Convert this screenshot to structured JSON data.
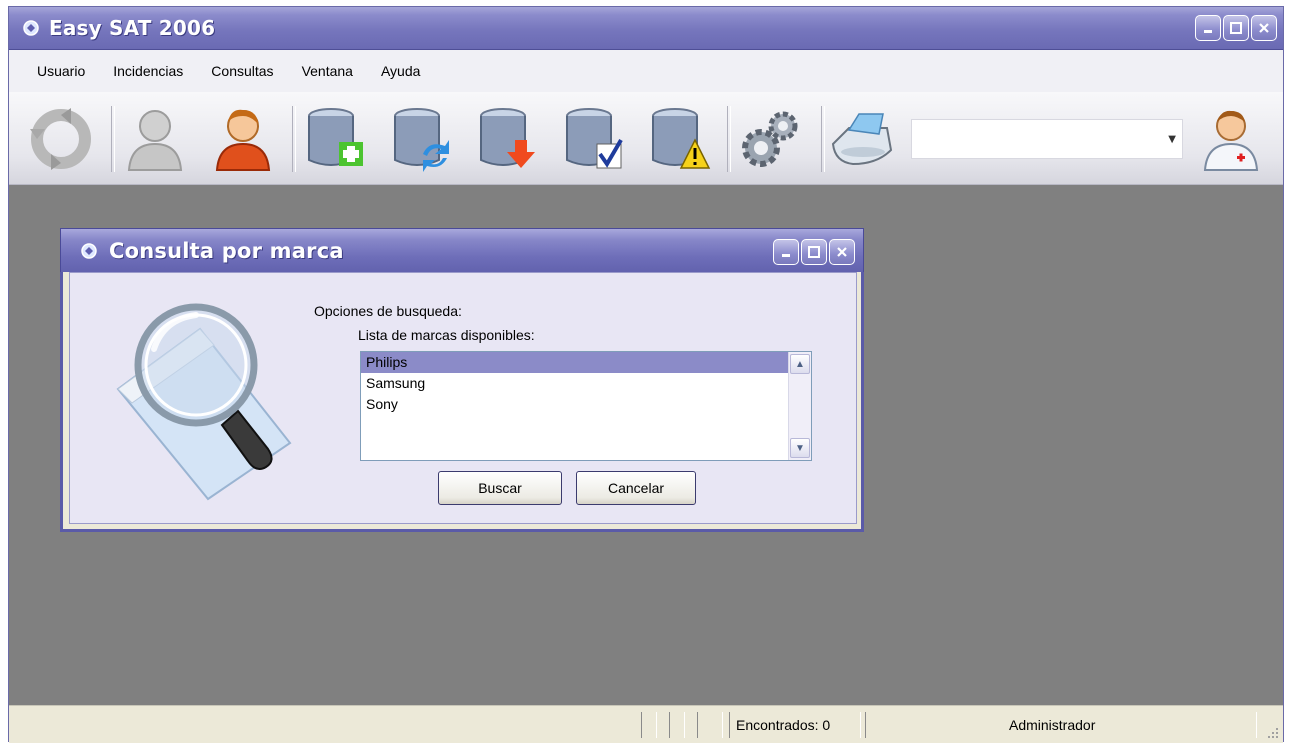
{
  "app": {
    "title": "Easy SAT 2006"
  },
  "menu": [
    {
      "label": "Usuario"
    },
    {
      "label": "Incidencias"
    },
    {
      "label": "Consultas"
    },
    {
      "label": "Ventana"
    },
    {
      "label": "Ayuda"
    }
  ],
  "toolbar": {
    "icons": [
      "refresh-icon",
      "user-gray-icon",
      "user-orange-icon",
      "database-add-icon",
      "database-sync-icon",
      "database-download-icon",
      "database-check-icon",
      "database-warning-icon",
      "gears-icon",
      "printer-icon",
      "doctor-user-icon"
    ],
    "combo_value": ""
  },
  "dialog": {
    "title": "Consulta por marca",
    "options_label": "Opciones de busqueda:",
    "list_label": "Lista de marcas disponibles:",
    "brands": [
      "Philips",
      "Samsung",
      "Sony"
    ],
    "selected": "Philips",
    "search_button": "Buscar",
    "cancel_button": "Cancelar"
  },
  "status": {
    "found": "Encontrados: 0",
    "user": "Administrador"
  },
  "colors": {
    "titlebar": "#7676bd",
    "client_background": "#808080",
    "selection": "#8b8bc8"
  }
}
